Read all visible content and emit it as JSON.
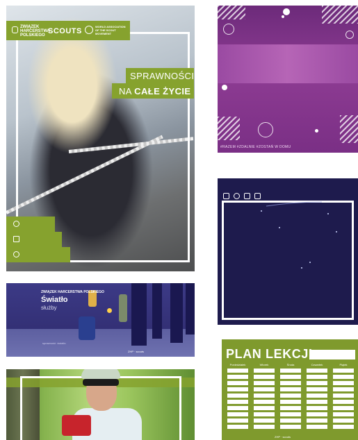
{
  "poster": {
    "org_line1": "ZWIĄZEK",
    "org_line2": "HARCERSTWA",
    "org_line3": "POLSKIEGO",
    "scouts": "SCOUTS",
    "wosm_line1": "WORLD ASSOCIATION",
    "wosm_line2": "OF THE SCOUT",
    "wosm_line3": "MOVEMENT",
    "title_line1": "SPRAWNOŚCI",
    "title_line2_prefix": "NA ",
    "title_line2_bold": "CAŁE ŻYCIE",
    "info_icons": [
      "clock-icon",
      "calendar-icon",
      "location-pin-icon"
    ],
    "accent": "#86a22e"
  },
  "purple": {
    "footer": "#RAZEM #ZDALNIE #ZOSTAŃ W DOMU",
    "color": "#8e3c93"
  },
  "navy": {
    "icons": [
      "fleur-de-lis-icon",
      "trefoil-icon",
      "badge-icon",
      "bookmark-icon"
    ],
    "color": "#1e1b4d"
  },
  "forest": {
    "brand": "ZWIĄZEK HARCERSTWA POLSKIEGO",
    "title": "Światło",
    "subtitle": "służby",
    "caption": "sprawność: światło",
    "footer": "ZHP  ·  scouts"
  },
  "greenphoto": {
    "color": "#86a22e"
  },
  "plan": {
    "title": "PLAN LEKCJI",
    "days": [
      "Poniedziałek",
      "Wtorek",
      "Środa",
      "Czwartek",
      "Piątek"
    ],
    "footer": "ZHP · scouts"
  }
}
